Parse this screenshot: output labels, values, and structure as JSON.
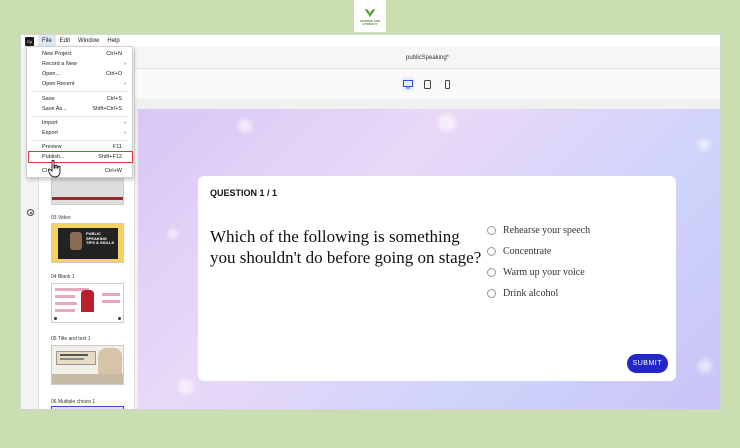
{
  "logo": {
    "text": "SCIENCE AND LITERACY"
  },
  "menubar": {
    "items": [
      "File",
      "Edit",
      "Window",
      "Help"
    ]
  },
  "document": {
    "title": "publicSpeaking*"
  },
  "file_menu": {
    "items": [
      {
        "label": "New Project",
        "shortcut": "Ctrl+N"
      },
      {
        "label": "Record a New",
        "shortcut": ""
      },
      {
        "label": "Open...",
        "shortcut": "Ctrl+O"
      },
      {
        "label": "Open Recent",
        "shortcut": ""
      },
      {
        "label": "Save",
        "shortcut": "Ctrl+S"
      },
      {
        "label": "Save As...",
        "shortcut": "Shift+Ctrl+S"
      },
      {
        "label": "Import",
        "shortcut": ""
      },
      {
        "label": "Export",
        "shortcut": ""
      },
      {
        "label": "Preview",
        "shortcut": "F11"
      },
      {
        "label": "Publish...",
        "shortcut": "Shift+F12"
      },
      {
        "label": "Cl",
        "shortcut": "Ctrl+W"
      }
    ]
  },
  "slides": [
    {
      "label": "03  Video",
      "thumb_text": "PUBLIC SPEAKING TIPS & SKILLS"
    },
    {
      "label": "04  Blank 1",
      "thumb_text": ""
    },
    {
      "label": "05  Title and text 1",
      "thumb_text": ""
    },
    {
      "label": "06  Multiple choice 1",
      "thumb_text": ""
    }
  ],
  "quiz": {
    "header": "QUESTION 1 / 1",
    "question": "Which of the following is something you shouldn't do before going on stage?",
    "options": [
      "Rehearse your speech",
      "Concentrate",
      "Warm up your voice",
      "Drink alcohol"
    ],
    "submit": "SUBMIT"
  },
  "colors": {
    "background": "#c9dfb1",
    "submit": "#2327c9",
    "highlight": "#d8383a"
  }
}
